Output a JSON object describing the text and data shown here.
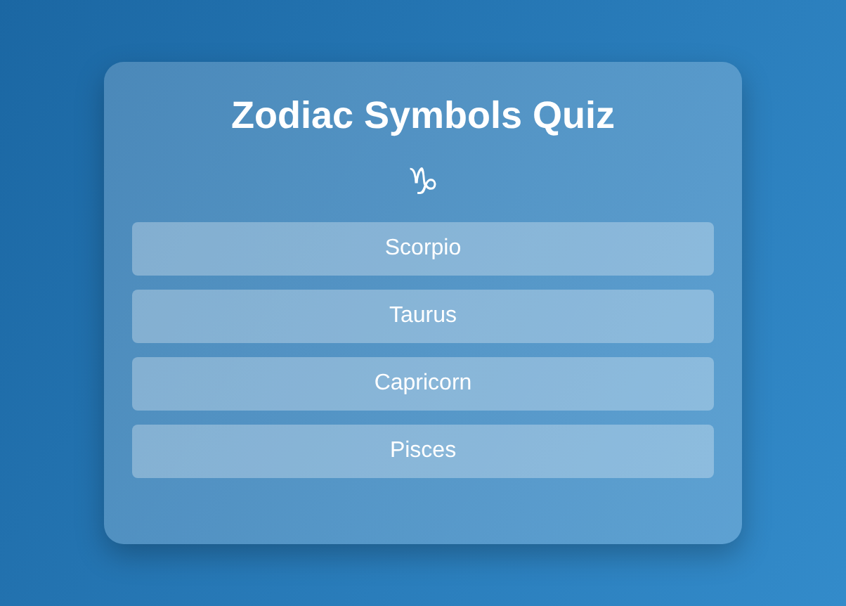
{
  "title": "Zodiac Symbols Quiz",
  "symbol": "♑",
  "options": [
    {
      "label": "Scorpio"
    },
    {
      "label": "Taurus"
    },
    {
      "label": "Capricorn"
    },
    {
      "label": "Pisces"
    }
  ]
}
